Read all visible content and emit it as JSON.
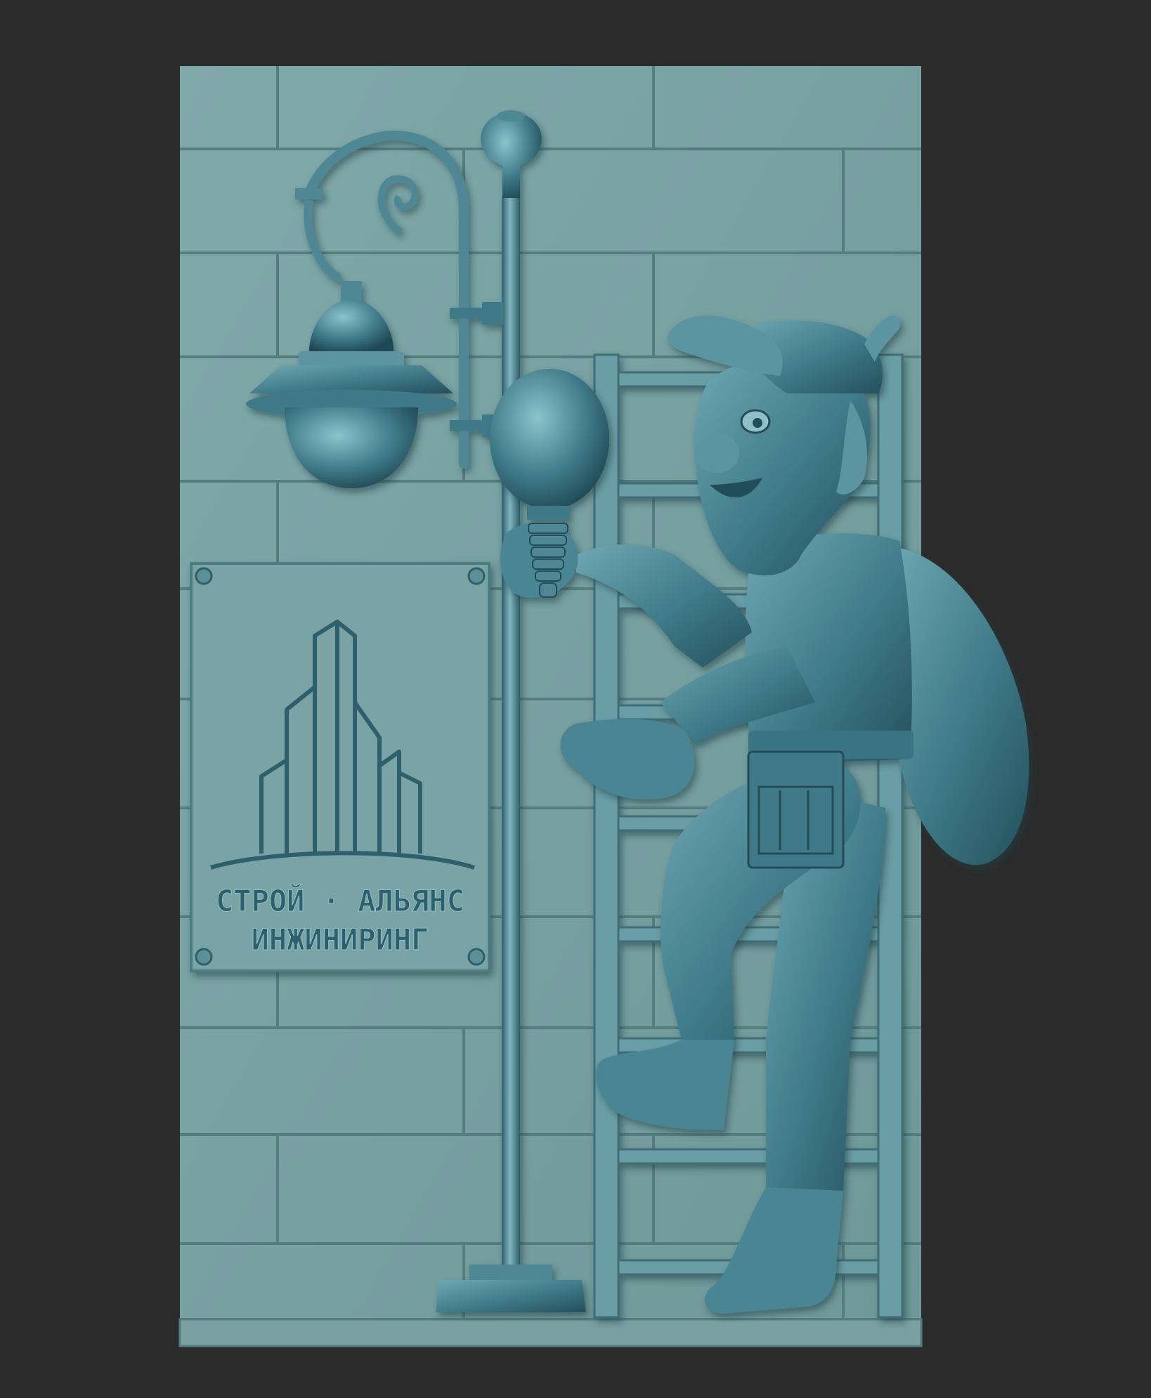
{
  "colors": {
    "background": "#2b2b2b",
    "wall": "#7ba3a4",
    "mortar": "#577f82",
    "relief": "#4f8894",
    "relief_dark": "#2f5f6c",
    "relief_light": "#8fc0c8"
  },
  "plaque": {
    "line1": "СТРОЙ · АЛЬЯНС",
    "line2": "ИНЖИНИРИНГ",
    "logo_icon": "skyscrapers-logo-icon"
  },
  "scene": {
    "subjects": [
      "brick-wall",
      "street-lamp",
      "ladder",
      "worker-figure",
      "company-plaque"
    ]
  }
}
